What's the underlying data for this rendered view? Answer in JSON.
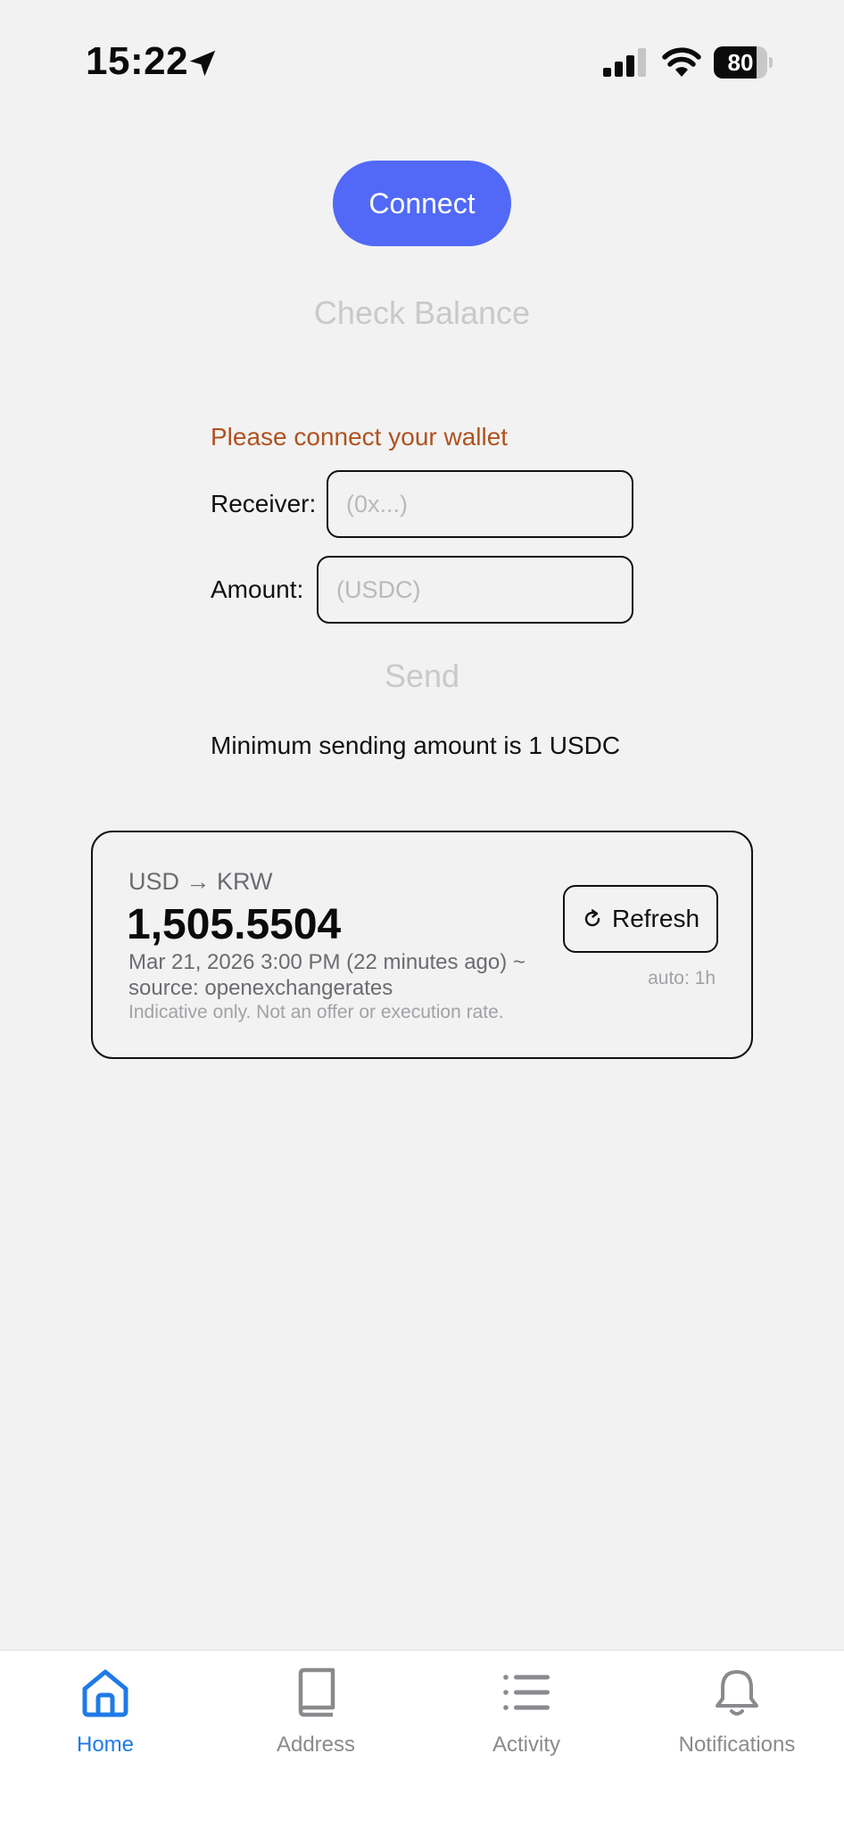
{
  "status_bar": {
    "time": "15:22",
    "battery": "80",
    "icons": [
      "location-arrow-icon",
      "cellular-signal-icon",
      "wifi-icon",
      "battery-icon"
    ]
  },
  "actions": {
    "connect_label": "Connect",
    "check_balance_label": "Check Balance",
    "send_label": "Send"
  },
  "form": {
    "warning": "Please connect your wallet",
    "receiver_label": "Receiver:",
    "receiver_placeholder": "(0x...)",
    "receiver_value": "",
    "amount_label": "Amount:",
    "amount_placeholder": "(USDC)",
    "amount_value": "",
    "min_note": "Minimum sending amount is 1 USDC"
  },
  "rate_card": {
    "pair": "USD → KRW",
    "value": "1,505.5504",
    "date": "Mar 21, 2026 3:00 PM (22 minutes ago) ~",
    "source": "source: openexchangerates",
    "disclaimer": "Indicative only. Not an offer or execution rate.",
    "refresh_label": "Refresh",
    "auto": "auto: 1h"
  },
  "tabs": [
    {
      "label": "Home",
      "icon": "home-icon",
      "active": true
    },
    {
      "label": "Address",
      "icon": "book-icon",
      "active": false
    },
    {
      "label": "Activity",
      "icon": "list-icon",
      "active": false
    },
    {
      "label": "Notifications",
      "icon": "bell-icon",
      "active": false
    }
  ],
  "colors": {
    "accent": "#5169f6",
    "tab_active": "#1f7ae8",
    "warning": "#b0521f",
    "background": "#f2f2f3"
  }
}
